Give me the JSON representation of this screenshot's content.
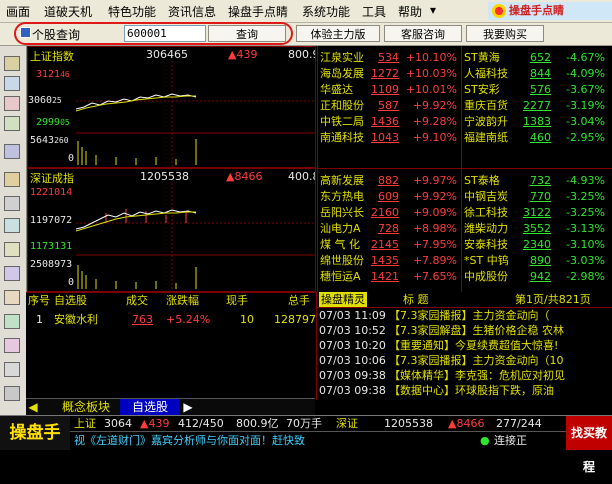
{
  "menu": [
    "画面",
    "道破天机",
    "特色功能",
    "资讯信息",
    "操盘手点睛",
    "系统功能",
    "工具",
    "帮助"
  ],
  "logo_text": "操盘手点睛",
  "toolbar": {
    "search_label": "个股查询",
    "search_value": "600001",
    "query_button": "查询",
    "buttons": [
      "体验主力版",
      "客服咨询",
      "我要购买"
    ]
  },
  "index_sh": {
    "name": "上证指数",
    "volume": "306465",
    "change": "▲439",
    "amount": "800.9",
    "price_ticks": [
      "3121",
      "46",
      "3060",
      "25",
      "2999",
      "05"
    ],
    "volume_ticks": [
      "5643",
      "260",
      "0"
    ]
  },
  "index_sz": {
    "name": "深证成指",
    "volume": "1205538",
    "change": "▲8466",
    "amount": "400.8",
    "price_ticks": [
      "1221014",
      "1197072",
      "1173131"
    ],
    "volume_ticks": [
      "2508973",
      "0"
    ]
  },
  "quotes_gainers_top": [
    {
      "name": "江泉实业",
      "price": "534",
      "change": "+10.10%"
    },
    {
      "name": "海岛发展",
      "price": "1272",
      "change": "+10.03%"
    },
    {
      "name": "华盛达",
      "price": "1109",
      "change": "+10.01%"
    },
    {
      "name": "正和股份",
      "price": "587",
      "change": "+9.92%"
    },
    {
      "name": "中铁二局",
      "price": "1436",
      "change": "+9.28%"
    },
    {
      "name": "南通科技",
      "price": "1043",
      "change": "+9.10%"
    }
  ],
  "quotes_losers_top": [
    {
      "name": "ST黄海",
      "price": "652",
      "change": "-4.67%"
    },
    {
      "name": "人福科技",
      "price": "844",
      "change": "-4.09%"
    },
    {
      "name": "ST安彩",
      "price": "576",
      "change": "-3.67%"
    },
    {
      "name": "重庆百货",
      "price": "2277",
      "change": "-3.19%"
    },
    {
      "name": "宁波韵升",
      "price": "1383",
      "change": "-3.04%"
    },
    {
      "name": "福建南纸",
      "price": "460",
      "change": "-2.95%"
    }
  ],
  "quotes_gainers_sz": [
    {
      "name": "高新发展",
      "price": "882",
      "change": "+9.97%"
    },
    {
      "name": "东方热电",
      "price": "609",
      "change": "+9.92%"
    },
    {
      "name": "岳阳兴长",
      "price": "2160",
      "change": "+9.09%"
    },
    {
      "name": "汕电力A",
      "price": "728",
      "change": "+8.98%"
    },
    {
      "name": "煤 气 化",
      "price": "2145",
      "change": "+7.95%"
    },
    {
      "name": "绵世股份",
      "price": "1435",
      "change": "+7.89%"
    },
    {
      "name": "穗恒运A",
      "price": "1421",
      "change": "+7.65%"
    }
  ],
  "quotes_losers_sz": [
    {
      "name": "ST泰格",
      "price": "732",
      "change": "-4.93%"
    },
    {
      "name": "中钢吉炭",
      "price": "770",
      "change": "-3.25%"
    },
    {
      "name": "徐工科技",
      "price": "3122",
      "change": "-3.25%"
    },
    {
      "name": "潍柴动力",
      "price": "3552",
      "change": "-3.13%"
    },
    {
      "name": "安泰科技",
      "price": "2340",
      "change": "-3.10%"
    },
    {
      "name": "*ST 中钨",
      "price": "890",
      "change": "-3.03%"
    },
    {
      "name": "中成股份",
      "price": "942",
      "change": "-2.98%"
    }
  ],
  "stock_list": {
    "headers": [
      "序号",
      "自选股",
      "成交",
      "涨跌幅",
      "现手",
      "总手"
    ],
    "rows": [
      {
        "no": "1",
        "name": "安徽水利",
        "price": "763",
        "change": "+5.24%",
        "hand": "10",
        "total": "128797"
      }
    ]
  },
  "news": {
    "title": "操盘精灵",
    "col_title": "标  题",
    "page": "第1页/共821页",
    "items": [
      {
        "time": "07/03 11:09",
        "text": "【7.3家园播报】主力资金动向（"
      },
      {
        "time": "07/03 10:52",
        "text": "【7.3家园解盘】生猪价格企稳 农林"
      },
      {
        "time": "07/03 10:20",
        "text": "【重要通知】今夏续费超值大惊喜!"
      },
      {
        "time": "07/03 10:06",
        "text": "【7.3家园播报】主力资金动向（10"
      },
      {
        "time": "07/03 09:38",
        "text": "【媒体精华】李克强：危机应对初见"
      },
      {
        "time": "07/03 09:38",
        "text": "【数据中心】环球股指下跌，原油"
      }
    ]
  },
  "tabs": [
    "概念板块",
    "自选股"
  ],
  "status": {
    "sh_label": "上证",
    "sh_value": "3064",
    "sh_change": "▲439",
    "sh_ratio": "412/450",
    "sh_amount": "800.9亿",
    "sh_hand": "70万手",
    "sz_label": "深证",
    "sz_value": "1205538",
    "sz_change": "▲8466",
    "sz_ratio": "277/244",
    "ticker_text": "视《左道财门》嘉宾分析师与你面对面！赶快致",
    "connection": "连接正",
    "brand": "操盘手",
    "corner": "找买教程"
  },
  "colors": {
    "up": "#ff3c3c",
    "down": "#2ee62e",
    "name": "#e0e000",
    "accent": "#e01818"
  }
}
